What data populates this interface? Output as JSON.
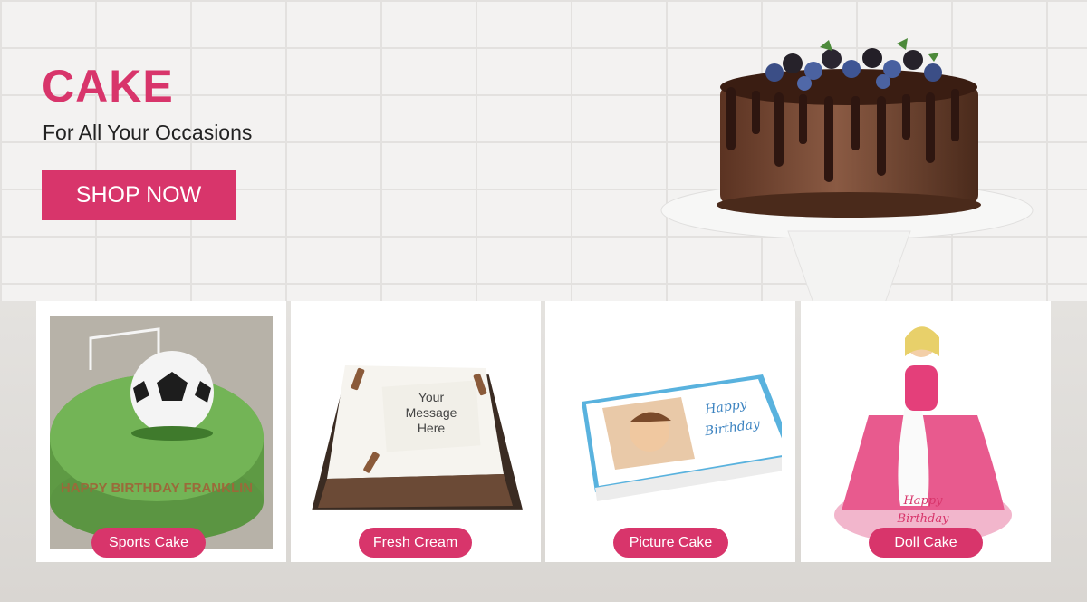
{
  "hero": {
    "title": "CAKE",
    "subtitle": "For All Your Occasions",
    "cta_label": "SHOP NOW"
  },
  "colors": {
    "accent": "#d8356b"
  },
  "categories": [
    {
      "label": "Sports Cake",
      "icon": "sports-cake-image"
    },
    {
      "label": "Fresh Cream",
      "icon": "fresh-cream-cake-image",
      "image_text": "Your Message Here"
    },
    {
      "label": "Picture Cake",
      "icon": "picture-cake-image",
      "image_text": "Happy Birthday"
    },
    {
      "label": "Doll Cake",
      "icon": "doll-cake-image",
      "image_text": "Happy Birthday"
    }
  ],
  "sports_cake_text": "HAPPY BIRTHDAY FRANKLIN"
}
